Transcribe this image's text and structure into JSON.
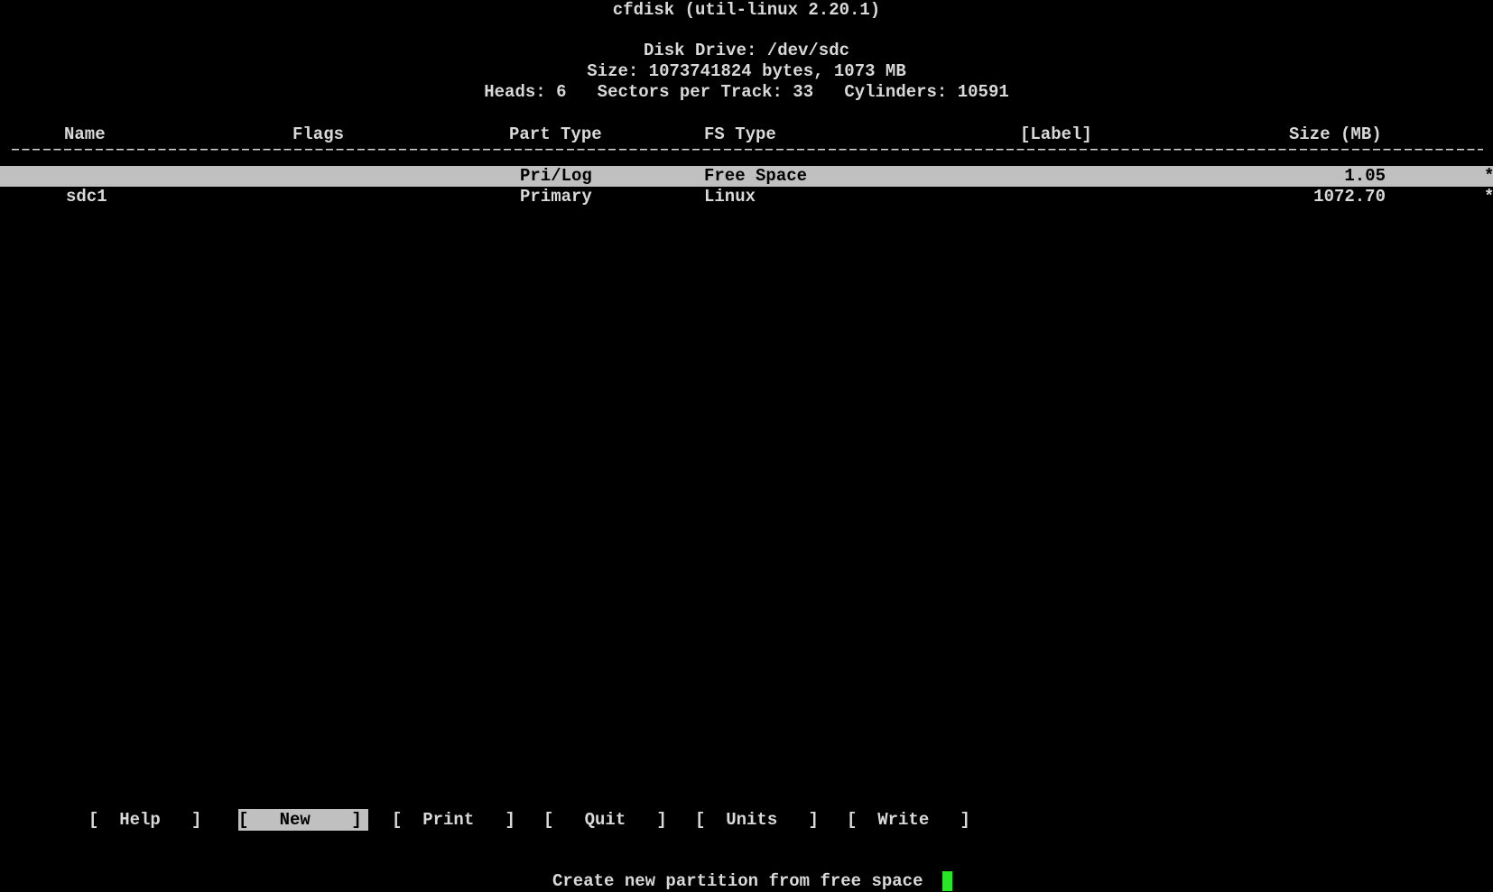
{
  "header": {
    "program": "cfdisk (util-linux 2.20.1)",
    "disk_drive": "Disk Drive: /dev/sdc",
    "size": "Size: 1073741824 bytes, 1073 MB",
    "geometry": "Heads: 6   Sectors per Track: 33   Cylinders: 10591"
  },
  "table": {
    "columns": [
      "Name",
      "Flags",
      "Part Type",
      "FS Type",
      "[Label]",
      "Size (MB)"
    ],
    "rows": [
      {
        "name": "",
        "flags": "",
        "part_type": "Pri/Log",
        "fs_type": "Free Space",
        "label": "",
        "size": "1.05",
        "marker": "*",
        "selected": true
      },
      {
        "name": "sdc1",
        "flags": "",
        "part_type": "Primary",
        "fs_type": "Linux",
        "label": "",
        "size": "1072.70",
        "marker": "*",
        "selected": false
      }
    ]
  },
  "menu": {
    "items": [
      {
        "label": "Help",
        "active": false
      },
      {
        "label": "New",
        "active": true
      },
      {
        "label": "Print",
        "active": false
      },
      {
        "label": "Quit",
        "active": false
      },
      {
        "label": "Units",
        "active": false
      },
      {
        "label": "Write",
        "active": false
      }
    ]
  },
  "status": {
    "text": "Create new partition from free space"
  },
  "colors": {
    "background": "#000000",
    "foreground": "#d9d9d9",
    "highlight": "#c0c0c0",
    "cursor": "#27e727"
  }
}
